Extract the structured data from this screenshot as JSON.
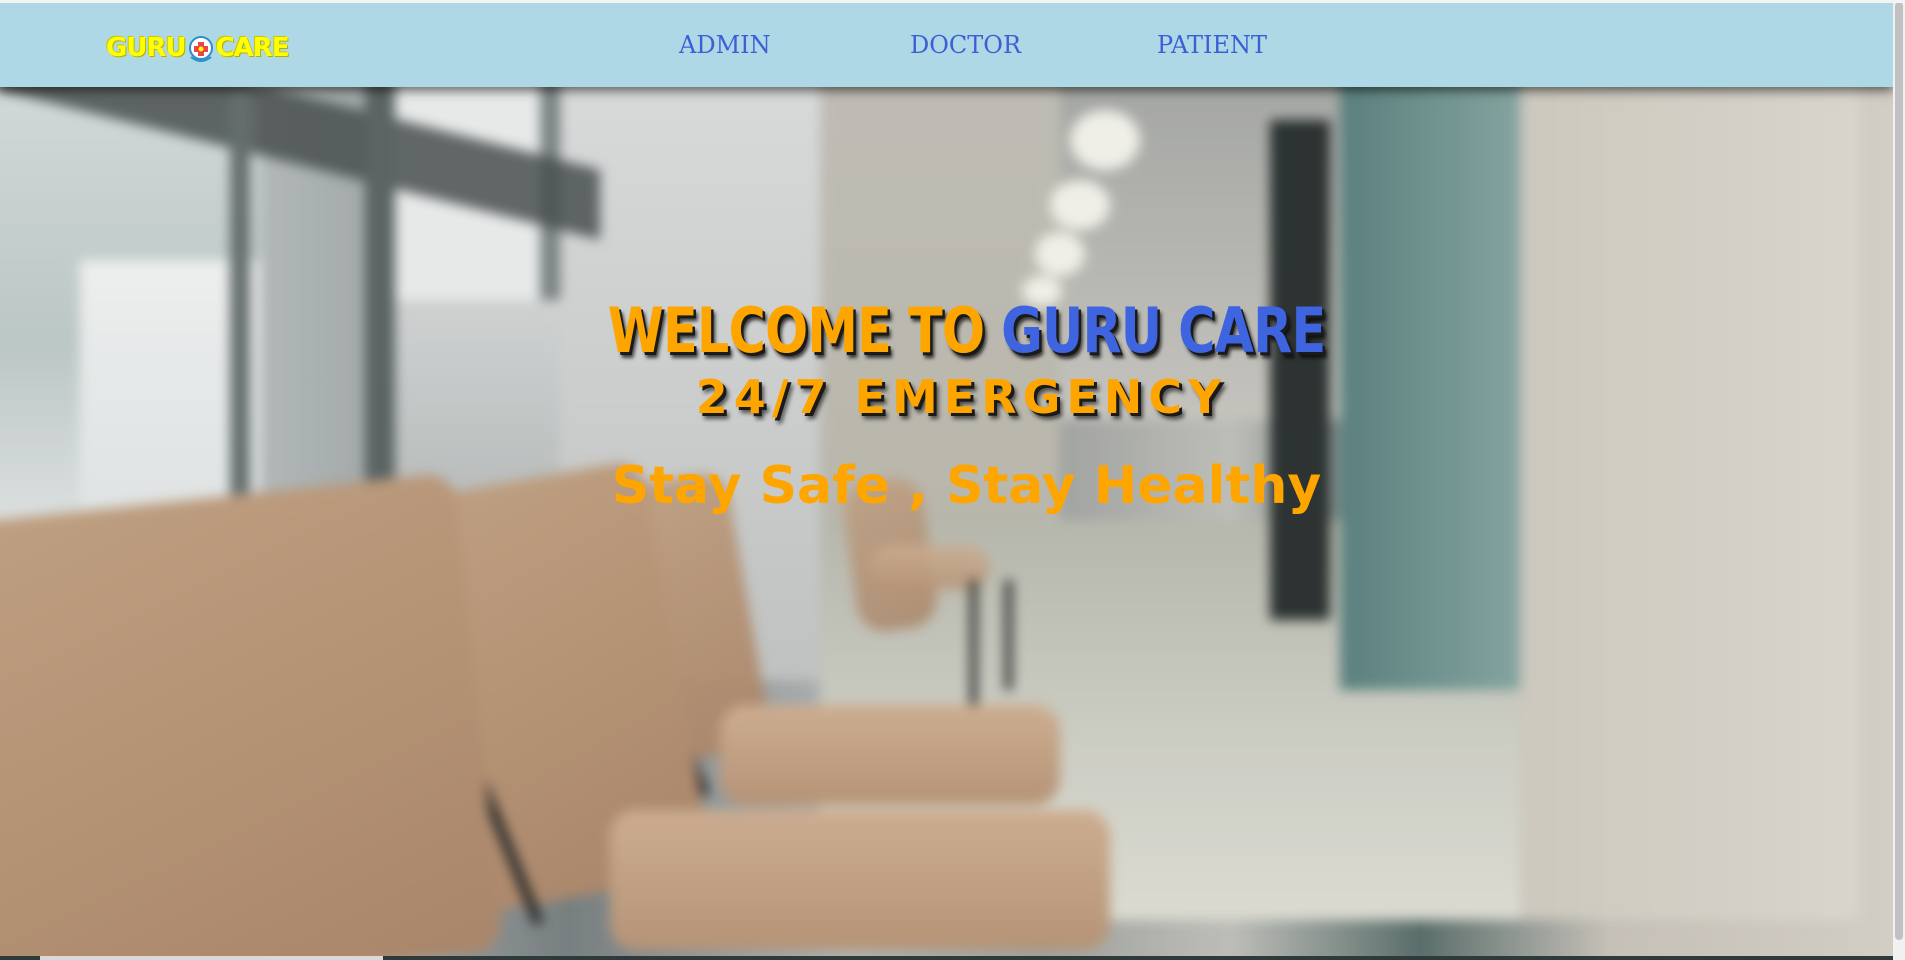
{
  "navbar": {
    "logo": {
      "text_left": "GURU",
      "text_right": "CARE",
      "emblem_icon": "medical-cross-emblem-icon",
      "color": "#ffff00"
    },
    "links": [
      {
        "label": "ADMIN"
      },
      {
        "label": "DOCTOR"
      },
      {
        "label": "PATIENT"
      }
    ],
    "background": "#aed8e6",
    "link_color": "#3d5fd4"
  },
  "hero": {
    "welcome_prefix": "WELCOME TO",
    "welcome_brand": "GURU CARE",
    "emergency": "24/7 EMERGENCY",
    "tagline": "Stay Safe , Stay Healthy",
    "accent_orange": "#ffa500",
    "accent_blue": "#3f64e0",
    "background_image": "blurred hospital corridor with waiting chairs"
  }
}
